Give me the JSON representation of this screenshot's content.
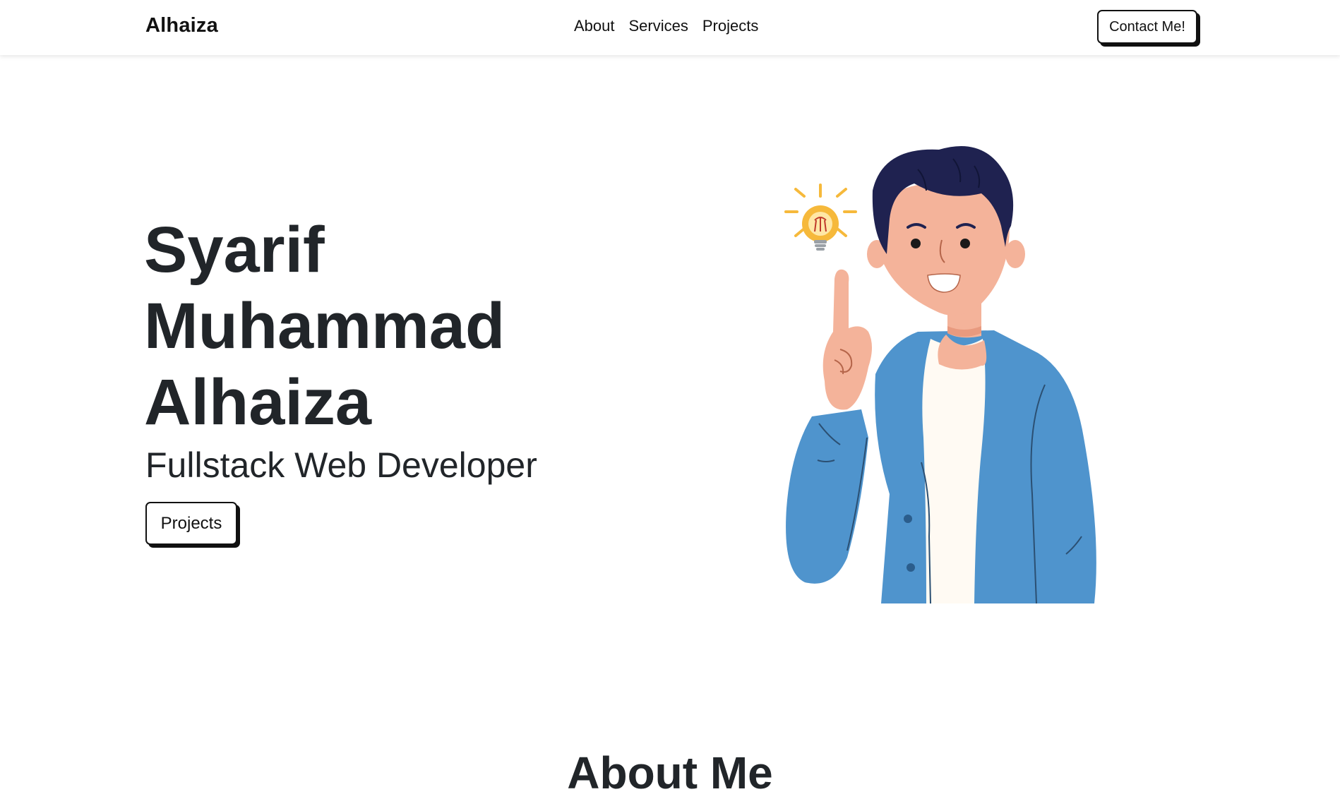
{
  "navbar": {
    "brand": "Alhaiza",
    "links": [
      "About",
      "Services",
      "Projects"
    ],
    "contact_label": "Contact Me!"
  },
  "hero": {
    "name_lines": [
      "Syarif",
      "Muhammad",
      "Alhaiza"
    ],
    "role": "Fullstack Web Developer",
    "projects_label": "Projects",
    "illustration_icon": "man-with-lightbulb-idea-illustration"
  },
  "about": {
    "heading": "About Me"
  },
  "colors": {
    "text_dark": "#212529",
    "jacket_blue": "#4f94cd",
    "hair_navy": "#1f2250",
    "skin": "#f4b39a",
    "bulb_yellow": "#f6b93b"
  }
}
